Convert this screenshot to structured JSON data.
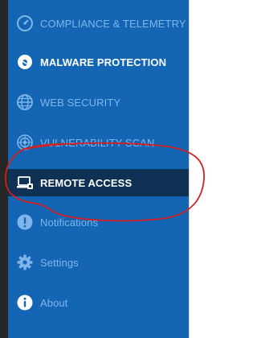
{
  "sidebar": {
    "items": [
      {
        "label": "COMPLIANCE & TELEMETRY",
        "icon": "gauge-icon"
      },
      {
        "label": "MALWARE PROTECTION",
        "icon": "shield-bug-icon"
      },
      {
        "label": "WEB SECURITY",
        "icon": "globe-icon"
      },
      {
        "label": "VULNERABILITY SCAN",
        "icon": "radar-icon"
      },
      {
        "label": "REMOTE ACCESS",
        "icon": "laptop-lock-icon",
        "active": true
      },
      {
        "label": "Notifications",
        "icon": "exclamation-icon"
      },
      {
        "label": "Settings",
        "icon": "gear-icon"
      },
      {
        "label": "About",
        "icon": "info-icon"
      }
    ]
  },
  "colors": {
    "sidebar_bg": "#1466b5",
    "active_bg": "#0f3153",
    "dim_text": "#7fb6ea",
    "annotation": "#d42020"
  }
}
